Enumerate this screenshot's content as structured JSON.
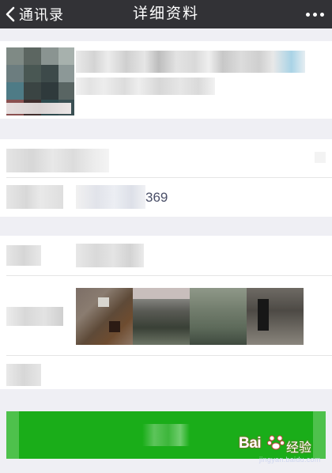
{
  "navbar": {
    "back_label": "通讯录",
    "title": "详细资料"
  },
  "phone": {
    "visible_digits": "369"
  },
  "watermark": {
    "brand": "Bai",
    "brand_suffix": "经验",
    "url": "jingyan.baidu.com"
  },
  "colors": {
    "navbar_bg": "#323236",
    "page_bg": "#efeff4",
    "card_bg": "#ffffff",
    "primary_button": "#1aad19",
    "phone_text": "#4a4f68"
  },
  "icons": {
    "back": "chevron-left-icon",
    "more": "more-dots-icon",
    "brand": "baidu-paw-icon"
  }
}
